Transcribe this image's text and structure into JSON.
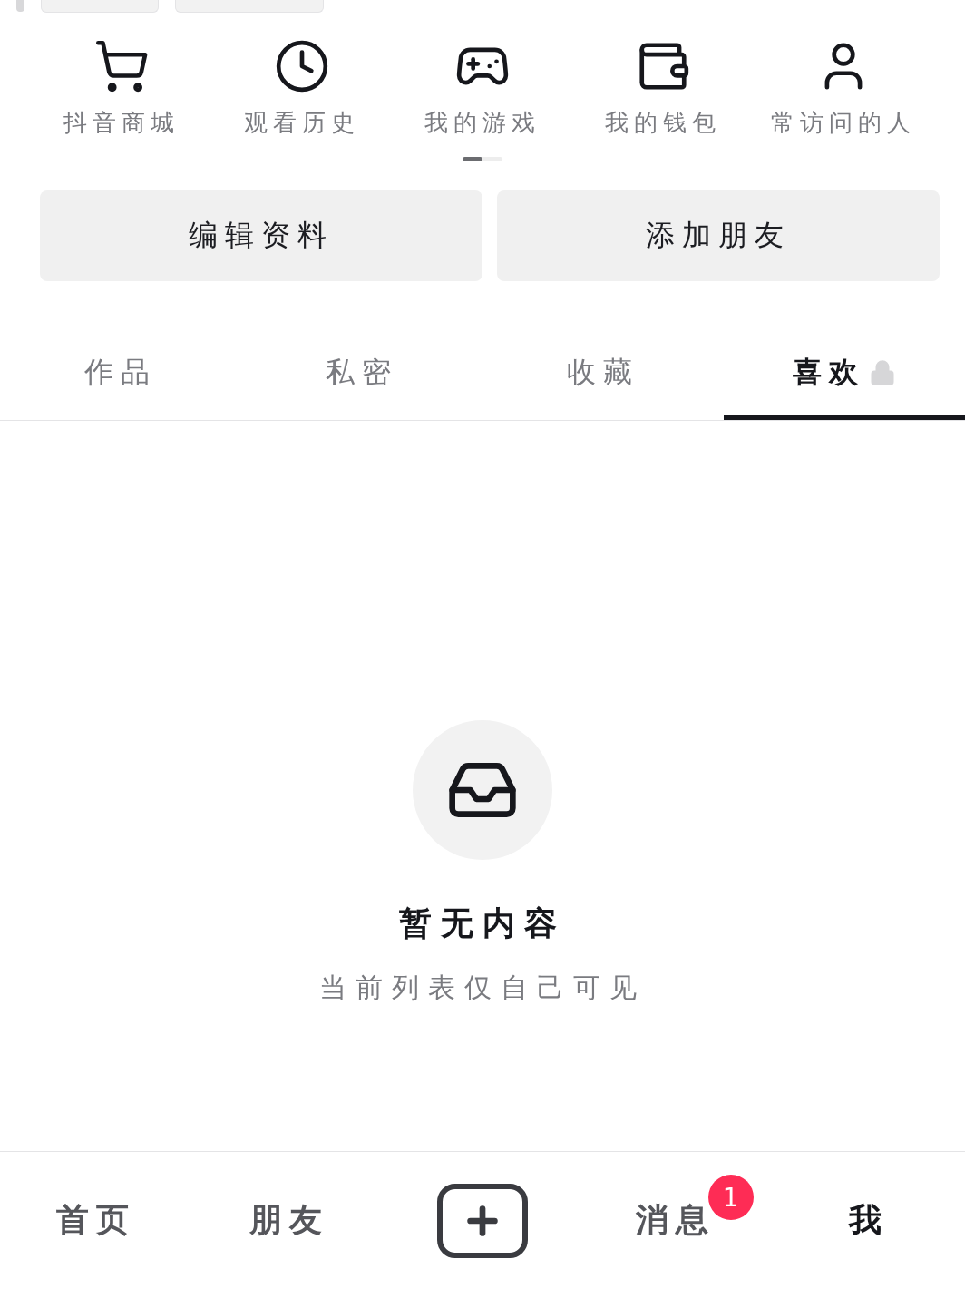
{
  "shortcuts": [
    {
      "label": "抖音商城"
    },
    {
      "label": "观看历史"
    },
    {
      "label": "我的游戏"
    },
    {
      "label": "我的钱包"
    },
    {
      "label": "常访问的人"
    }
  ],
  "actions": [
    "编辑资料",
    "添加朋友"
  ],
  "tabs": [
    {
      "label": "作品",
      "selected": false,
      "locked": false
    },
    {
      "label": "私密",
      "selected": false,
      "locked": false
    },
    {
      "label": "收藏",
      "selected": false,
      "locked": false
    },
    {
      "label": "喜欢",
      "selected": true,
      "locked": true
    }
  ],
  "empty_state": {
    "title": "暂无内容",
    "subtitle": "当前列表仅自己可见"
  },
  "bottom_nav": [
    {
      "label": "首页",
      "selected": false
    },
    {
      "label": "朋友",
      "selected": false
    },
    {
      "kind": "create"
    },
    {
      "label": "消息",
      "selected": false,
      "badge": "1"
    },
    {
      "label": "我",
      "selected": true
    }
  ]
}
